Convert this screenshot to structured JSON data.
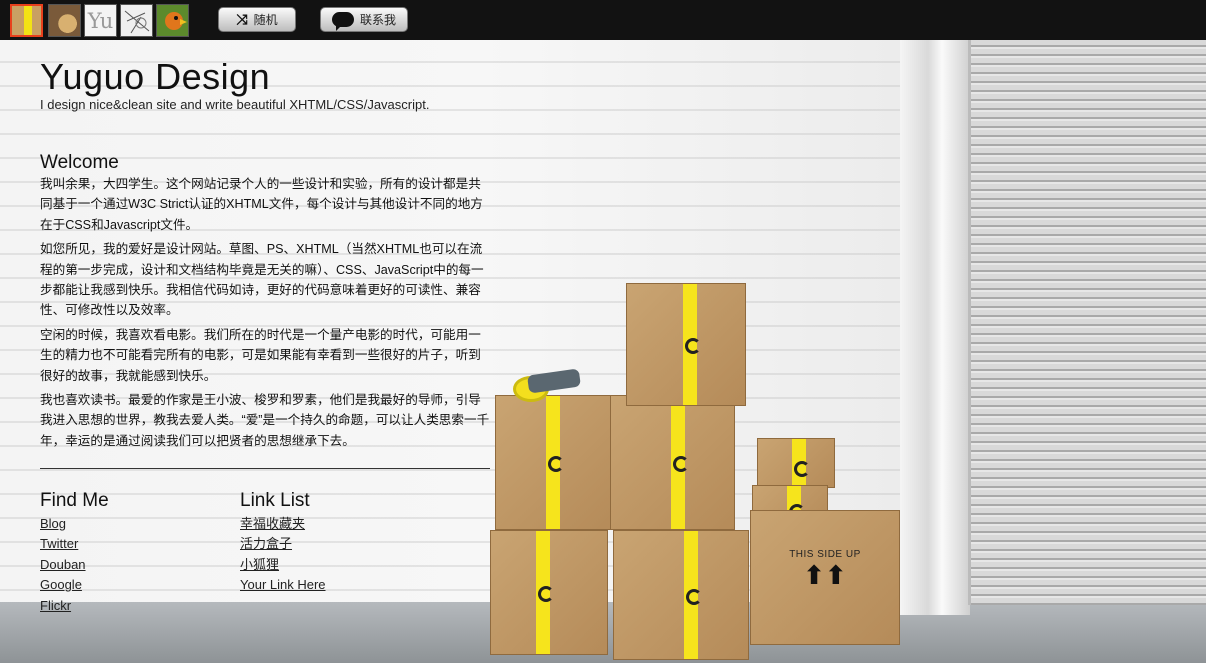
{
  "topbar": {
    "themes": [
      {
        "name": "theme-boxes"
      },
      {
        "name": "theme-coffee"
      },
      {
        "name": "theme-yu",
        "label": "Yu"
      },
      {
        "name": "theme-sketch"
      },
      {
        "name": "theme-bird"
      }
    ],
    "random_label": "随机",
    "contact_label": "联系我"
  },
  "header": {
    "title": "Yuguo Design",
    "tagline": "I design nice&clean site and write beautiful XHTML/CSS/Javascript."
  },
  "welcome": {
    "heading": "Welcome",
    "paragraphs": [
      "我叫余果，大四学生。这个网站记录个人的一些设计和实验，所有的设计都是共同基于一个通过W3C Strict认证的XHTML文件，每个设计与其他设计不同的地方在于CSS和Javascript文件。",
      "如您所见，我的爱好是设计网站。草图、PS、XHTML（当然XHTML也可以在流程的第一步完成，设计和文档结构毕竟是无关的嘛）、CSS、JavaScript中的每一步都能让我感到快乐。我相信代码如诗，更好的代码意味着更好的可读性、兼容性、可修改性以及效率。",
      "空闲的时候，我喜欢看电影。我们所在的时代是一个量产电影的时代，可能用一生的精力也不可能看完所有的电影，可是如果能有幸看到一些很好的片子，听到很好的故事，我就能感到快乐。",
      "我也喜欢读书。最爱的作家是王小波、梭罗和罗素，他们是我最好的导师，引导我进入思想的世界，教我去爱人类。“爱”是一个持久的命题，可以让人类思索一千年，幸运的是通过阅读我们可以把贤者的思想继承下去。"
    ]
  },
  "find_me": {
    "heading": "Find Me",
    "links": [
      "Blog",
      "Twitter",
      "Douban",
      "Google",
      "Flickr"
    ]
  },
  "link_list": {
    "heading": "Link List",
    "links": [
      "幸福收藏夹",
      "活力盒子",
      "小狐狸",
      "Your Link Here"
    ]
  },
  "scene": {
    "box_label": "THIS SIDE UP",
    "box_arrows": "⬆⬆"
  },
  "colors": {
    "topbar_bg": "#121212",
    "active_theme_border": "#e8401c",
    "tape": "#f6e41c",
    "cardboard": "#c9a472"
  }
}
